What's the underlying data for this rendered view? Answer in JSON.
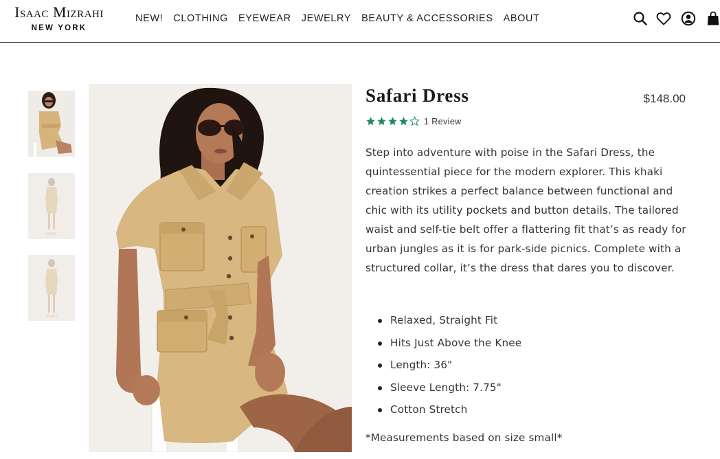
{
  "header": {
    "logo": {
      "line1": "Isaac Mizrahi",
      "line2": "NEW YORK"
    },
    "nav": [
      {
        "label": "NEW!"
      },
      {
        "label": "CLOTHING"
      },
      {
        "label": "EYEWEAR"
      },
      {
        "label": "JEWELRY"
      },
      {
        "label": "BEAUTY & ACCESSORIES"
      },
      {
        "label": "ABOUT"
      }
    ],
    "icons": [
      "search-icon",
      "heart-icon",
      "account-icon",
      "shopping-bag-icon"
    ]
  },
  "gallery": {
    "thumbnails": [
      "model-seated-front",
      "model-standing-front",
      "model-standing-back"
    ],
    "main_image": "model-seated-khaki-safari-dress"
  },
  "product": {
    "title": "Safari Dress",
    "price": "$148.00",
    "rating": {
      "value": 4,
      "max": 5,
      "color": "#1a8a6a"
    },
    "review_count_label": "1 Review",
    "description": "Step into adventure with poise in the Safari Dress, the quintessential piece for the modern explorer. This khaki creation strikes a perfect balance between functional and chic with its utility pockets and button details. The tailored waist and self-tie belt offer a flattering fit that’s as ready for urban jungles as it is for park-side picnics. Complete with a structured collar, it’s the dress that dares you to discover.",
    "features": [
      "Relaxed, Straight Fit",
      "Hits Just Above the Knee",
      "Length: 36\"",
      "Sleeve Length: 7.75\"",
      "Cotton Stretch"
    ],
    "note": "*Measurements based on size small*"
  },
  "colors": {
    "dress": "#d9b982",
    "background": "#f1eeea",
    "accent": "#1a8a6a"
  }
}
